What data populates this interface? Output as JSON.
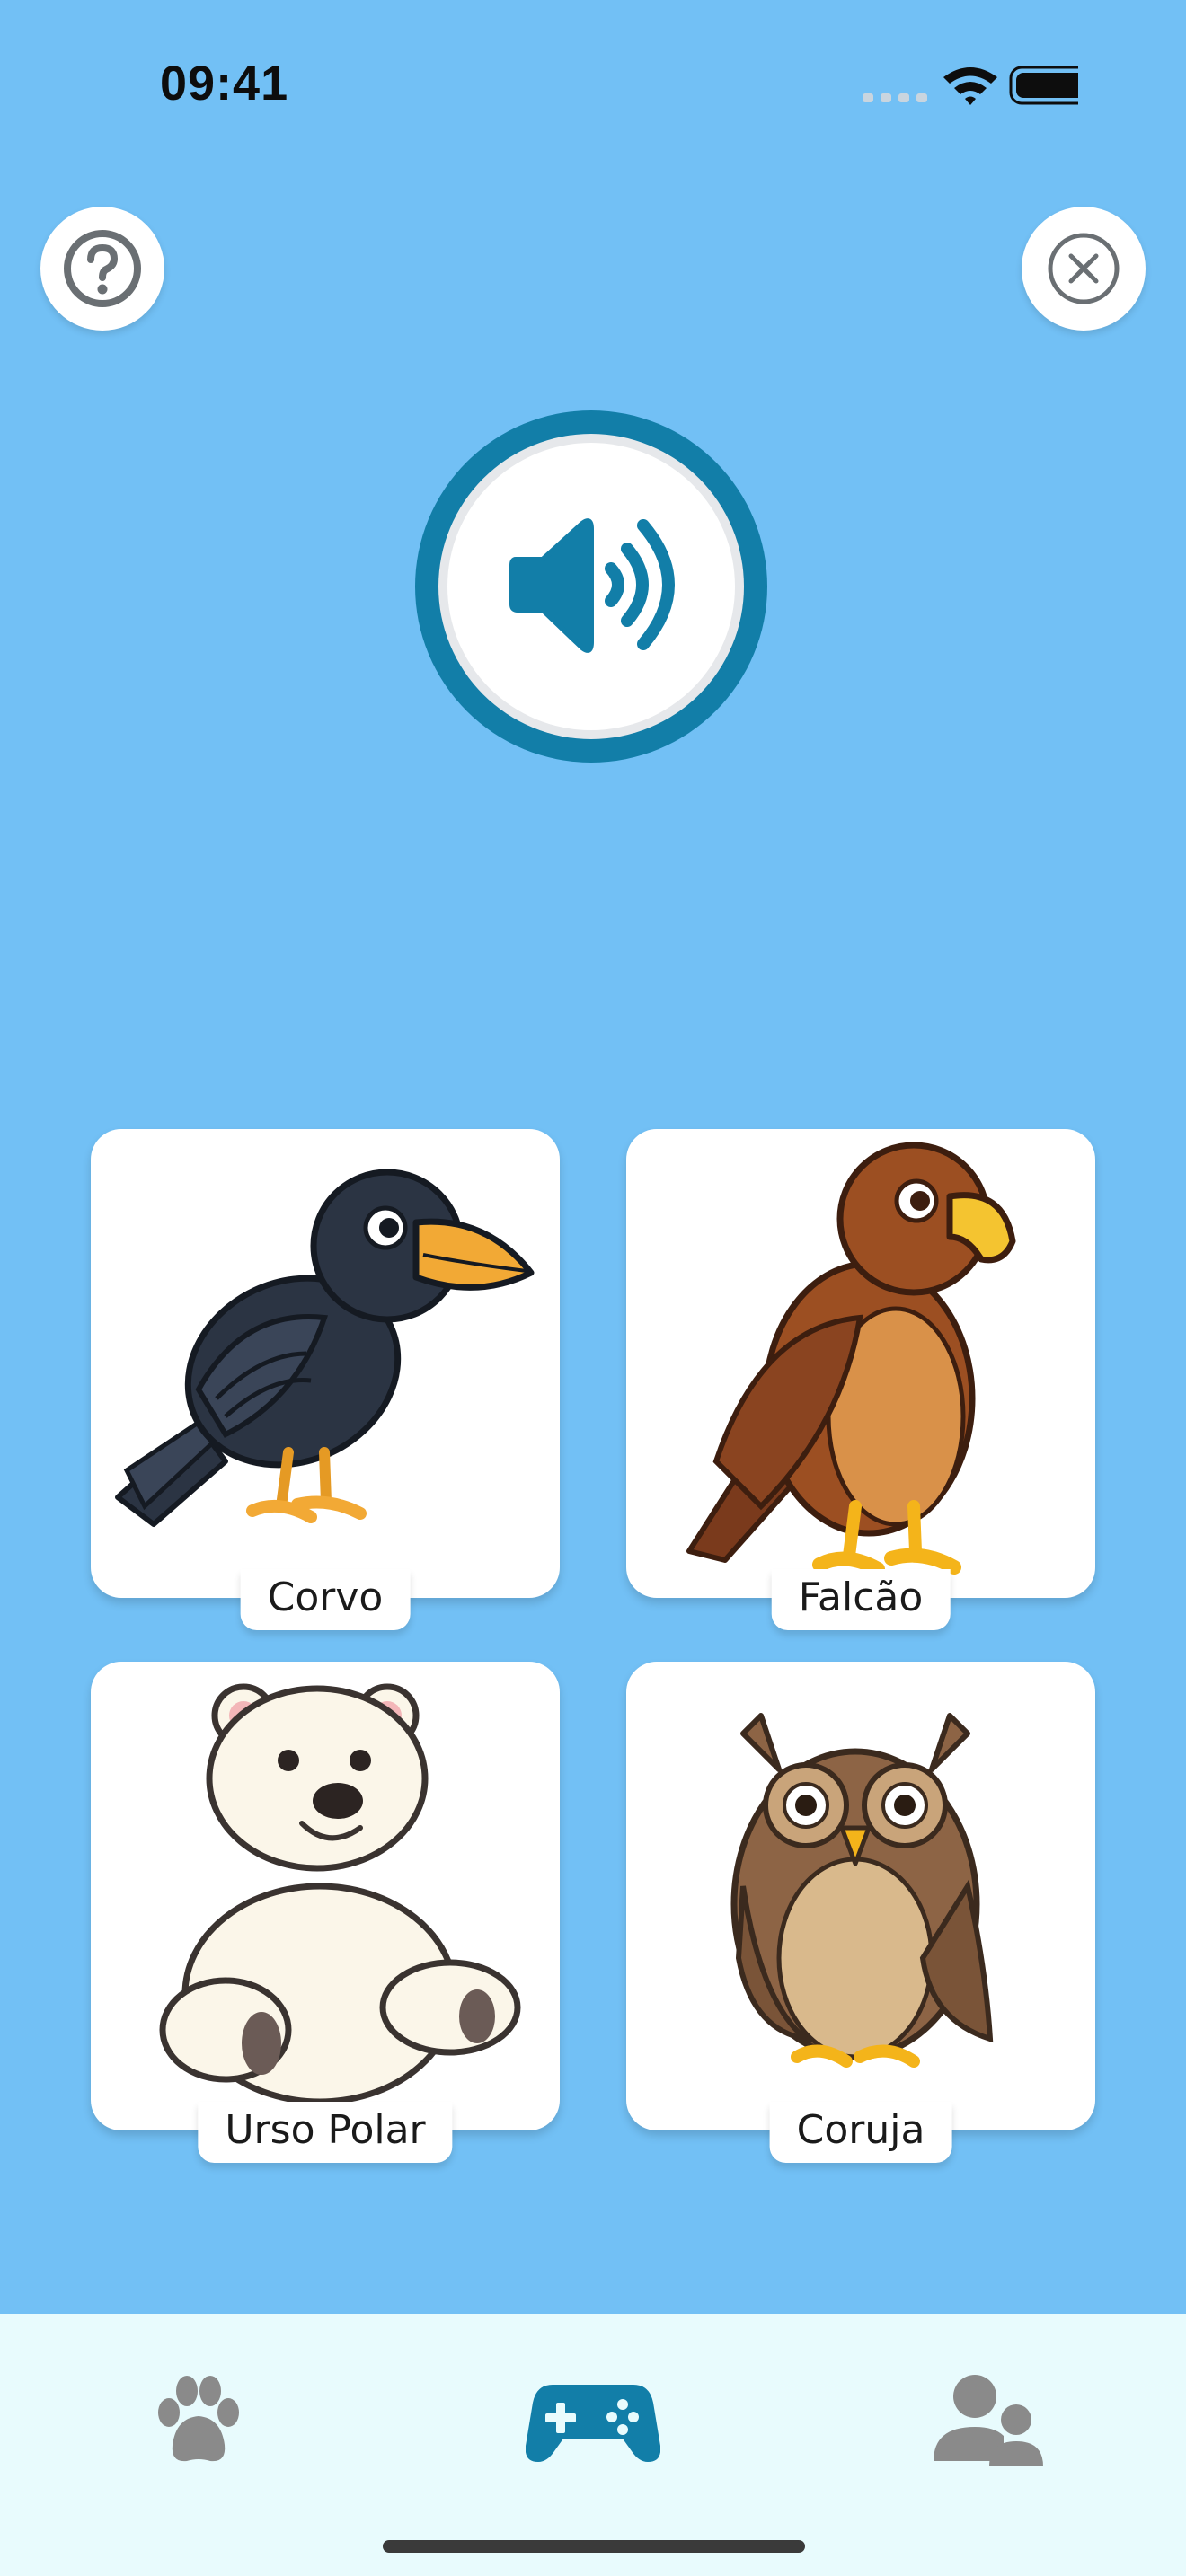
{
  "status_bar": {
    "time": "09:41"
  },
  "header": {
    "help_icon": "question-circle-icon",
    "close_icon": "x-circle-icon"
  },
  "audio": {
    "icon": "speaker-wave-icon"
  },
  "options": [
    {
      "label": "Corvo",
      "animal": "crow"
    },
    {
      "label": "Falcão",
      "animal": "hawk"
    },
    {
      "label": "Urso Polar",
      "animal": "polar-bear"
    },
    {
      "label": "Coruja",
      "animal": "owl"
    }
  ],
  "tabs": [
    {
      "icon": "paw-icon",
      "active": false
    },
    {
      "icon": "gamepad-icon",
      "active": true
    },
    {
      "icon": "users-icon",
      "active": false
    }
  ],
  "colors": {
    "background": "#72c0f5",
    "accent": "#127ea8",
    "tabbar": "#e8fbfd",
    "inactive_icon": "#8a8a8a"
  }
}
